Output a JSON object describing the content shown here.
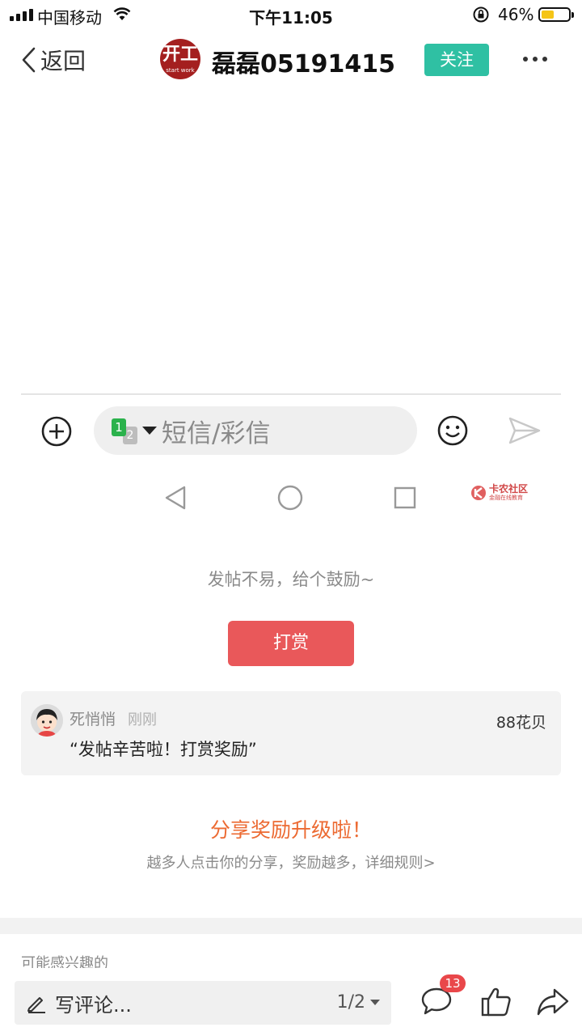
{
  "status_bar": {
    "carrier": "中国移动",
    "time": "下午11:05",
    "battery_percent": "46%",
    "battery_level": 0.46
  },
  "nav": {
    "back_label": "返回",
    "avatar_text": "开工",
    "avatar_subtext": "start work",
    "username": "磊磊05191415",
    "follow_label": "关注"
  },
  "embedded_screenshot": {
    "sim_primary": "1",
    "sim_secondary": "2",
    "input_placeholder": "短信/彩信",
    "watermark_title": "卡农社区",
    "watermark_subtitle": "金融在线教育"
  },
  "reward": {
    "hint": "发帖不易，给个鼓励~",
    "button_label": "打赏",
    "record": {
      "user": "死悄悄",
      "time": "刚刚",
      "amount": "88花贝",
      "message": "“发帖辛苦啦！打赏奖励”"
    }
  },
  "share": {
    "title": "分享奖励升级啦！",
    "description": "越多人点击你的分享，奖励越多，详细规则>"
  },
  "related": {
    "title": "可能感兴趣的"
  },
  "bottom_bar": {
    "comment_placeholder": "写评论...",
    "page_indicator": "1/2",
    "comment_count": "13"
  },
  "colors": {
    "accent_green": "#2fc0a3",
    "reward_red": "#e9585a",
    "share_orange": "#ec6a32",
    "badge_red": "#e9474a"
  }
}
